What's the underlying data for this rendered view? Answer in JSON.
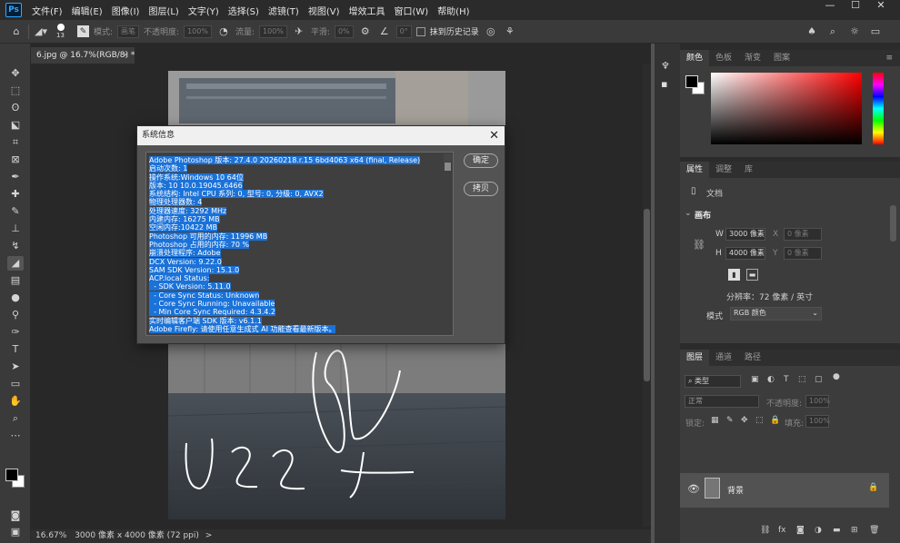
{
  "menubar": {
    "logo": "Ps",
    "items": [
      "文件(F)",
      "编辑(E)",
      "图像(I)",
      "图层(L)",
      "文字(Y)",
      "选择(S)",
      "滤镜(T)",
      "视图(V)",
      "增效工具",
      "窗口(W)",
      "帮助(H)"
    ],
    "min": "—",
    "max": "☐",
    "close": "✕"
  },
  "options": {
    "brush_size": "13",
    "mode_label": "模式:",
    "mode_value": "画笔",
    "opacity_label": "不透明度:",
    "opacity_value": "100%",
    "flow_label": "流量:",
    "flow_value": "100%",
    "smooth_label": "平滑:",
    "smooth_value": "0%",
    "angle_value": "0°",
    "erase_history_label": "抹到历史记录"
  },
  "document": {
    "tab_label": "6.jpg @ 16.7%(RGB/8) *",
    "tab_close": "×",
    "zoom": "16.67%",
    "status": "3000 像素 x 4000 像素 (72 ppi)",
    "status_arrow": ">"
  },
  "dialog": {
    "title": "系统信息",
    "close": "✕",
    "ok_label": "确定",
    "copy_label": "拷贝",
    "lines": [
      "Adobe Photoshop 版本: 27.4.0 20260218.r.15 6bd4063  x64 (final, Release)",
      "启动次数: 1",
      "操作系统:Windows 10 64位",
      "版本: 10 10.0.19045.6466",
      "系统结构: Intel CPU 系列: 0, 型号: 0, 分级: 0, AVX2",
      "物理处理器数: 4",
      "处理器速度: 3292 MHz",
      "内建内存: 16275 MB",
      "空闲内存:10422 MB",
      "Photoshop 可用的内存: 11996 MB",
      "Photoshop 占用的内存: 70 %",
      "崩溃处理程序: Adobe",
      "DCX Version: 9.22.0",
      "SAM SDK Version: 15.1.0",
      "ACP.local Status:",
      "  - SDK Version: 5.11.0",
      "  - Core Sync Status: Unknown",
      "  - Core Sync Running: Unavailable",
      "  - Min Core Sync Required: 4.3.4.2",
      "实时编辑客户端 SDK 版本: v6.1.1",
      "Adobe Firefly: 请使用任意生成式 AI 功能查看最新版本。"
    ]
  },
  "panels": {
    "color": {
      "tabs": [
        "颜色",
        "色板",
        "渐变",
        "图案"
      ]
    },
    "properties": {
      "tabs": [
        "属性",
        "调整",
        "库"
      ],
      "doc_label": "文档",
      "section": "画布",
      "w_label": "W",
      "w_value": "3000 像素",
      "h_label": "H",
      "h_value": "4000 像素",
      "x_label": "X",
      "x_value": "0 像素",
      "y_label": "Y",
      "y_value": "0 像素",
      "resolution": "分辨率：72 像素 / 英寸",
      "mode_label": "模式",
      "mode_value": "RGB 颜色"
    },
    "layers": {
      "tabs": [
        "图层",
        "通道",
        "路径"
      ],
      "filter_label": "类型",
      "blend_mode": "正常",
      "opacity_label": "不透明度:",
      "opacity_value": "100%",
      "lock_label": "锁定:",
      "fill_label": "填充:",
      "fill_value": "100%",
      "layer_name": "背景"
    }
  },
  "colors": {
    "accent": "#1b72d8",
    "ps_blue": "#31a8ff",
    "foreground": "#000000",
    "background": "#ffffff",
    "hue_base": "#ff0000"
  }
}
